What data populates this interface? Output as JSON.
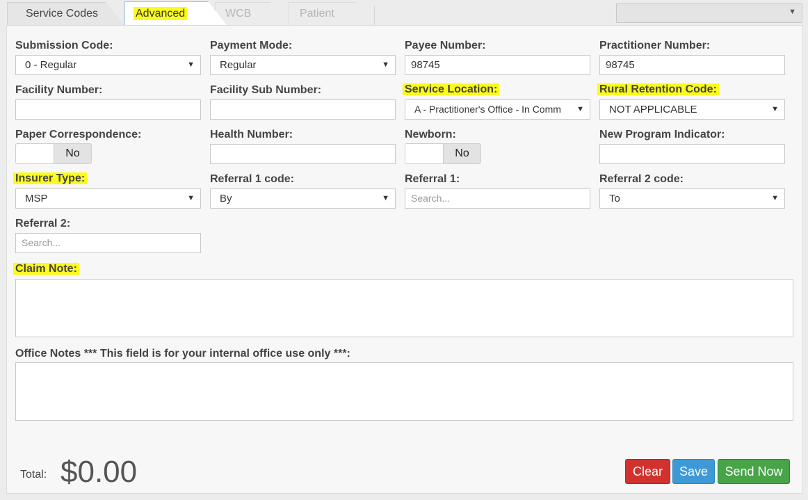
{
  "tabs": [
    {
      "label": "Service Codes",
      "state": "normal"
    },
    {
      "label": "Advanced",
      "state": "active"
    },
    {
      "label": "WCB",
      "state": "disabled"
    },
    {
      "label": "Patient",
      "state": "disabled"
    }
  ],
  "top_select": {
    "value": ""
  },
  "form": {
    "submission_code": {
      "label": "Submission Code:",
      "value": "0 - Regular"
    },
    "payment_mode": {
      "label": "Payment Mode:",
      "value": "Regular"
    },
    "payee_number": {
      "label": "Payee Number:",
      "value": "98745"
    },
    "practitioner_number": {
      "label": "Practitioner Number:",
      "value": "98745"
    },
    "facility_number": {
      "label": "Facility Number:",
      "value": ""
    },
    "facility_sub_number": {
      "label": "Facility Sub Number:",
      "value": ""
    },
    "service_location": {
      "label": "Service Location:",
      "value": "A - Practitioner's Office - In Comm"
    },
    "rural_retention_code": {
      "label": "Rural Retention Code:",
      "value": "NOT APPLICABLE"
    },
    "paper_correspondence": {
      "label": "Paper Correspondence:",
      "value": "No"
    },
    "health_number": {
      "label": "Health Number:",
      "value": ""
    },
    "newborn": {
      "label": "Newborn:",
      "value": "No"
    },
    "new_program_indicator": {
      "label": "New Program Indicator:",
      "value": ""
    },
    "insurer_type": {
      "label": "Insurer Type:",
      "value": "MSP"
    },
    "referral_1_code": {
      "label": "Referral 1 code:",
      "value": "By"
    },
    "referral_1": {
      "label": "Referral 1:",
      "placeholder": "Search..."
    },
    "referral_2_code": {
      "label": "Referral 2 code:",
      "value": "To"
    },
    "referral_2": {
      "label": "Referral 2:",
      "placeholder": "Search..."
    },
    "claim_note": {
      "label": "Claim Note:",
      "value": ""
    },
    "office_notes": {
      "label": "Office Notes *** This field is for your internal office use only ***:",
      "value": ""
    }
  },
  "footer": {
    "total_label": "Total:",
    "total_value": "$0.00",
    "buttons": {
      "clear": "Clear",
      "save": "Save",
      "send_now": "Send Now"
    }
  },
  "colors": {
    "highlight": "#fbfb1c",
    "clear": "#d2322d",
    "save": "#3e9ad6",
    "send_now": "#47a447"
  },
  "icons": {
    "caret": "caret-down-icon"
  }
}
